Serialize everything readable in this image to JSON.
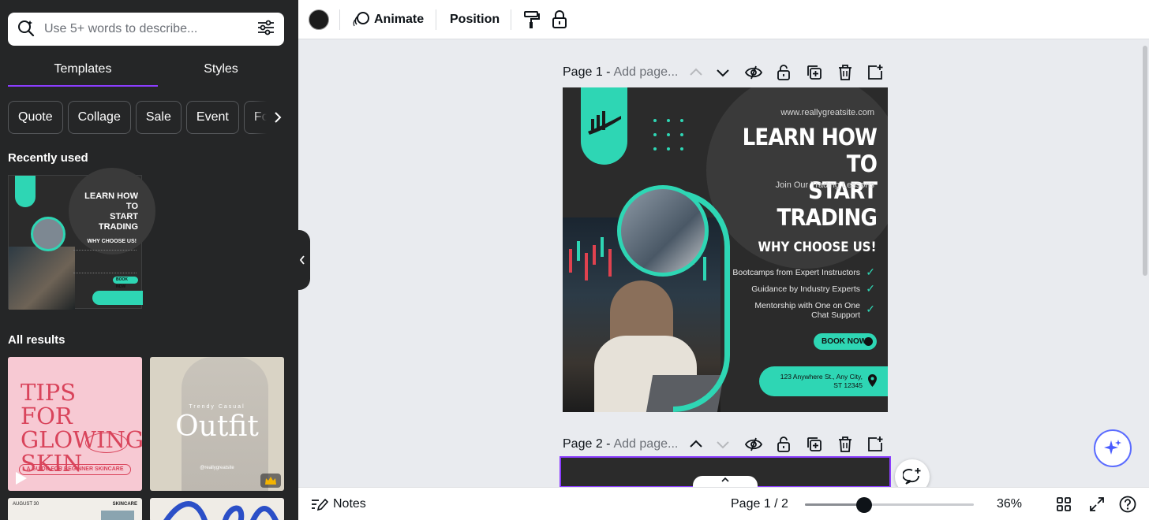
{
  "left_panel": {
    "search_placeholder": "Use 5+ words to describe...",
    "tabs": [
      "Templates",
      "Styles"
    ],
    "chips": [
      "Quote",
      "Collage",
      "Sale",
      "Event",
      "Foo"
    ],
    "recently_used_title": "Recently used",
    "all_results_title": "All results",
    "mini": {
      "title_line1": "LEARN HOW TO",
      "title_line2": "START TRADING",
      "why": "WHY CHOOSE US!",
      "book": "BOOK NOW"
    },
    "results": {
      "pink_title": "TIPS FOR GLOWING SKIN",
      "pink_tag": "A GUIDE FOR BEGINNER SKINCARE",
      "beige_small": "Trendy Casual",
      "beige_title": "Outfit",
      "beige_handle": "@reallygreatsite",
      "white_date": "AUGUST 30",
      "white_tag": "SKINCARE"
    }
  },
  "toolbar": {
    "animate": "Animate",
    "position": "Position",
    "color": "#1c1c1c"
  },
  "pages": [
    {
      "label": "Page 1 -",
      "placeholder": "Add page..."
    },
    {
      "label": "Page 2 -",
      "placeholder": "Add page..."
    }
  ],
  "design": {
    "site": "www.reallygreatsite.com",
    "title_line1": "LEARN HOW TO",
    "title_line2": "START TRADING",
    "subtitle": "Join Our Trading Lessons",
    "why": "WHY CHOOSE US!",
    "items": [
      "Bootcamps from Expert Instructors",
      "Guidance by Industry Experts",
      "Mentorship with One on One",
      "Chat Support"
    ],
    "book": "BOOK NOW",
    "address_line1": "123 Anywhere St., Any City,",
    "address_line2": "ST 12345",
    "accent": "#2ed6b4"
  },
  "bottom_bar": {
    "notes": "Notes",
    "page_indicator": "Page 1 / 2",
    "zoom_label": "36%",
    "zoom_fraction": 0.35
  },
  "colors": {
    "panel_bg": "#252627",
    "accent_purple": "#8b3dff",
    "canvas_bg": "#e9ebef"
  }
}
